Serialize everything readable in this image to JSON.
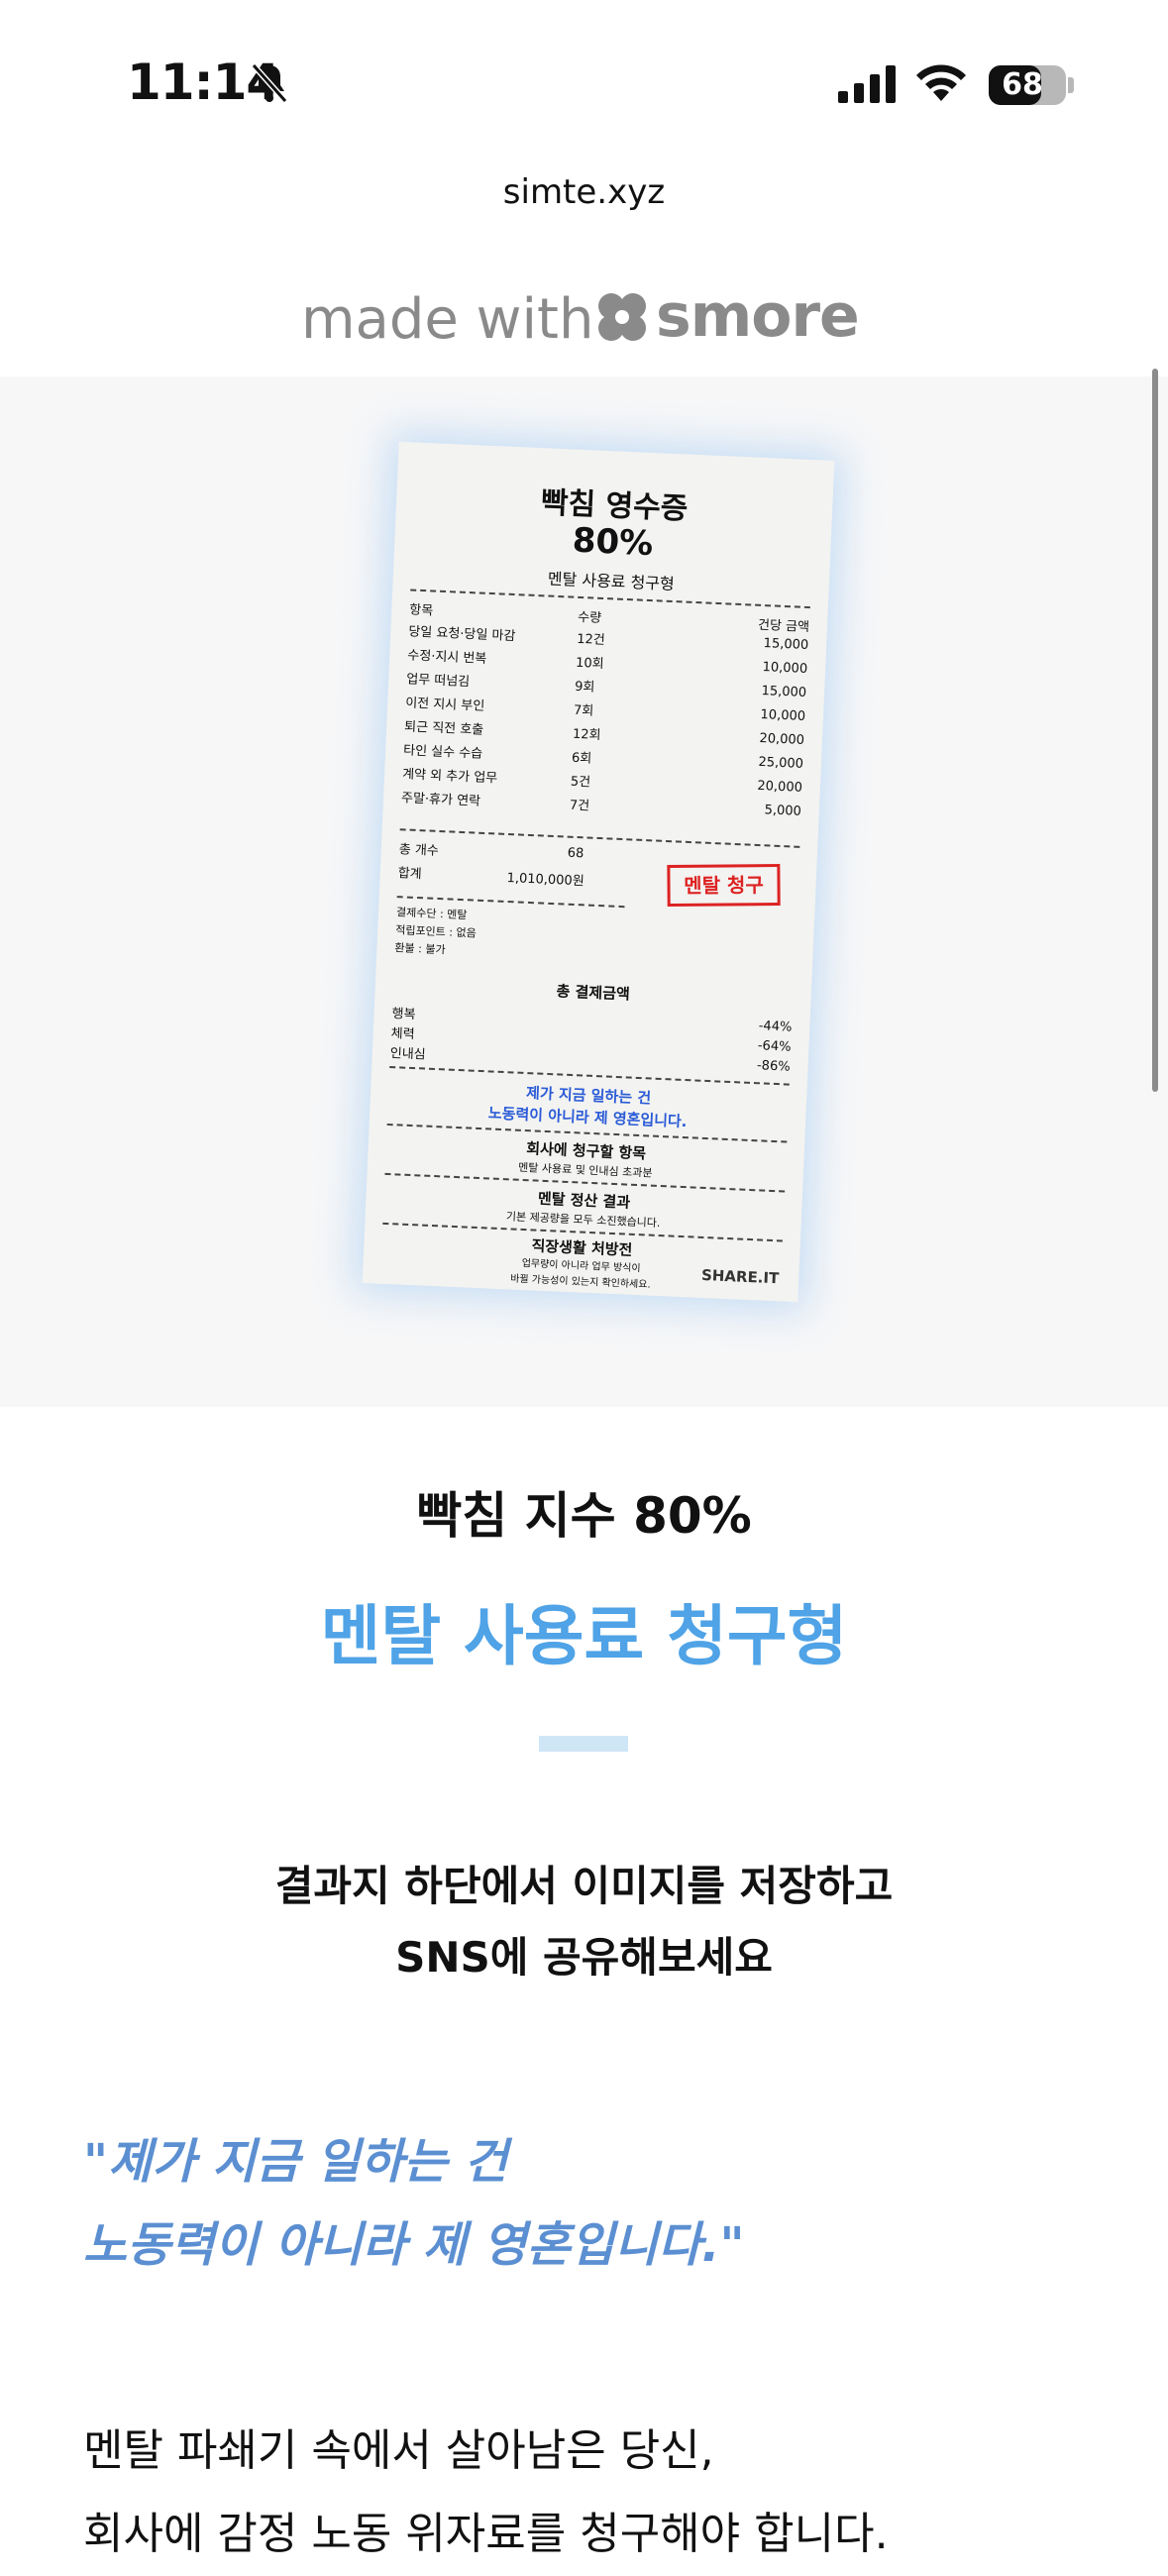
{
  "status_bar": {
    "time": "11:14",
    "battery": "68",
    "battery_level": 0.68
  },
  "site": {
    "url": "simte.xyz"
  },
  "branding": {
    "made_with": "made with",
    "brand": "smore"
  },
  "receipt": {
    "title": "빡침 영수증",
    "percent": "80%",
    "subtitle": "멘탈 사용료 청구형",
    "col_item": "항목",
    "col_qty": "수량",
    "col_amount": "건당 금액",
    "rows": [
      {
        "item": "당일 요청·당일 마감",
        "qty": "12건",
        "amount": "15,000"
      },
      {
        "item": "수정·지시 번복",
        "qty": "10회",
        "amount": "10,000"
      },
      {
        "item": "업무 떠넘김",
        "qty": "9회",
        "amount": "15,000"
      },
      {
        "item": "이전 지시 부인",
        "qty": "7회",
        "amount": "10,000"
      },
      {
        "item": "퇴근 직전 호출",
        "qty": "12회",
        "amount": "20,000"
      },
      {
        "item": "타인 실수 수습",
        "qty": "6회",
        "amount": "25,000"
      },
      {
        "item": "계약 외 추가 업무",
        "qty": "5건",
        "amount": "20,000"
      },
      {
        "item": "주말·휴가 연락",
        "qty": "7건",
        "amount": "5,000"
      }
    ],
    "total_count_label": "총 개수",
    "total_count": "68",
    "sum_label": "합계",
    "sum": "1,010,000원",
    "stamp": "멘탈 청구",
    "payment": "결제수단 : 멘탈",
    "points": "적립포인트 : 없음",
    "refund": "환불 : 불가",
    "pay_total": "총 결제금액",
    "stats": [
      {
        "label": "행복",
        "value": "-44%"
      },
      {
        "label": "체력",
        "value": "-64%"
      },
      {
        "label": "인내심",
        "value": "-86%"
      }
    ],
    "quote1": "제가 지금 일하는 건",
    "quote2": "노동력이 아니라 제 영혼입니다.",
    "claim_title": "회사에 청구할 항목",
    "claim_desc": "멘탈 사용료 및 인내심 초과분",
    "result_title": "멘탈 정산 결과",
    "result_desc": "기본 제공량을 모두 소진했습니다.",
    "rx_title": "직장생활 처방전",
    "rx_desc1": "업무량이 아니라 업무 방식이",
    "rx_desc2": "바뀔 가능성이 있는지 확인하세요.",
    "share": "SHARE.IT"
  },
  "result": {
    "index": "빡침 지수 80%",
    "type": "멘탈 사용료 청구형",
    "guide_line1": "결과지 하단에서 이미지를 저장하고",
    "guide_line2": "SNS에 공유해보세요",
    "quote_line1": "\"제가 지금 일하는 건",
    "quote_line2": "노동력이 아니라 제 영혼입니다.\"",
    "body_line1": "멘탈 파쇄기 속에서 살아남은 당신,",
    "body_line2": "회사에 감정 노동 위자료를 청구해야 합니다."
  }
}
